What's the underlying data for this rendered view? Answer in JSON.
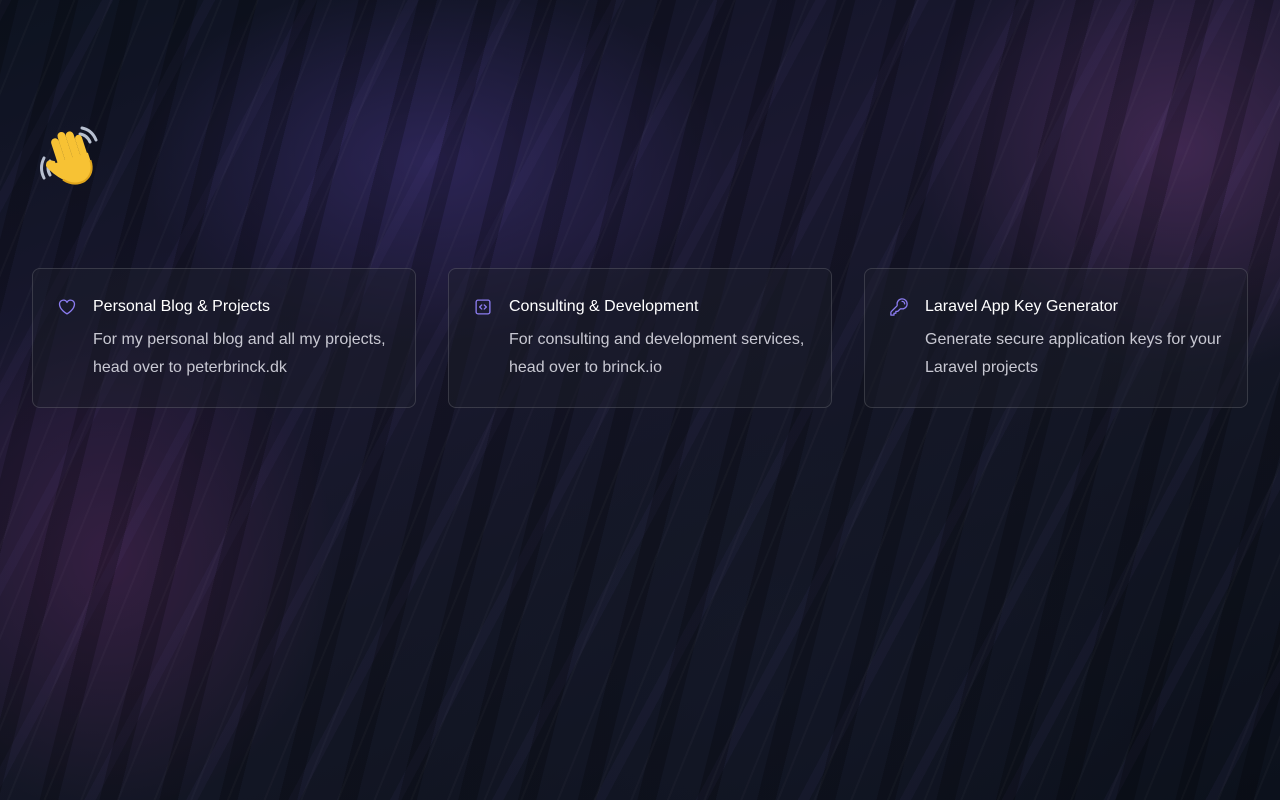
{
  "hero": {
    "emoji": "👋"
  },
  "cards": [
    {
      "icon": "heart-icon",
      "title": "Personal Blog & Projects",
      "description_line1": "For my personal blog and all my projects,",
      "description_line2": "head over to peterbrinck.dk"
    },
    {
      "icon": "code-bracket-square-icon",
      "title": "Consulting & Development",
      "description_line1": "For consulting and development services,",
      "description_line2": "head over to brinck.io"
    },
    {
      "icon": "key-icon",
      "title": "Laravel App Key Generator",
      "description_line1": "Generate secure application keys for your",
      "description_line2": "Laravel projects"
    }
  ],
  "colors": {
    "icon_accent": "#8b7cf0",
    "title": "#ffffff",
    "description": "#c8c8d2",
    "card_border": "rgba(255,255,255,0.14)"
  }
}
